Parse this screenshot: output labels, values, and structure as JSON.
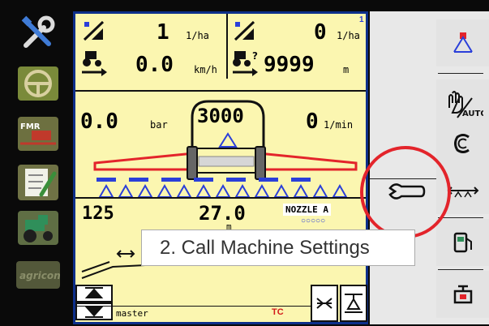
{
  "main": {
    "application_rate": "1",
    "application_rate_unit": "1/ha",
    "application_rate_2": "0",
    "application_rate_2_unit": "1/ha",
    "superscript_index": "1",
    "speed": "0.0",
    "speed_unit": "km/h",
    "distance": "9999",
    "distance_unit": "m",
    "pressure": "0.0",
    "pressure_unit": "bar",
    "tank_volume": "3000",
    "flow": "0",
    "flow_unit": "1/min",
    "boom_left_value": "125",
    "working_width": "27.0",
    "working_width_unit": "m",
    "nozzle_label": "NOZZLE A",
    "nozzle_dots": "○○○○○",
    "status_text": "master",
    "tc_badge": "TC"
  },
  "callout": {
    "text": "2. Call Machine Settings"
  },
  "rightbar": {
    "auto_label": "AUTO"
  },
  "colors": {
    "panel_bg": "#fbf6b0",
    "border_blue": "#0d2f8a",
    "highlight_red": "#e3242b",
    "nozzle_blue": "#2a3fd9"
  }
}
